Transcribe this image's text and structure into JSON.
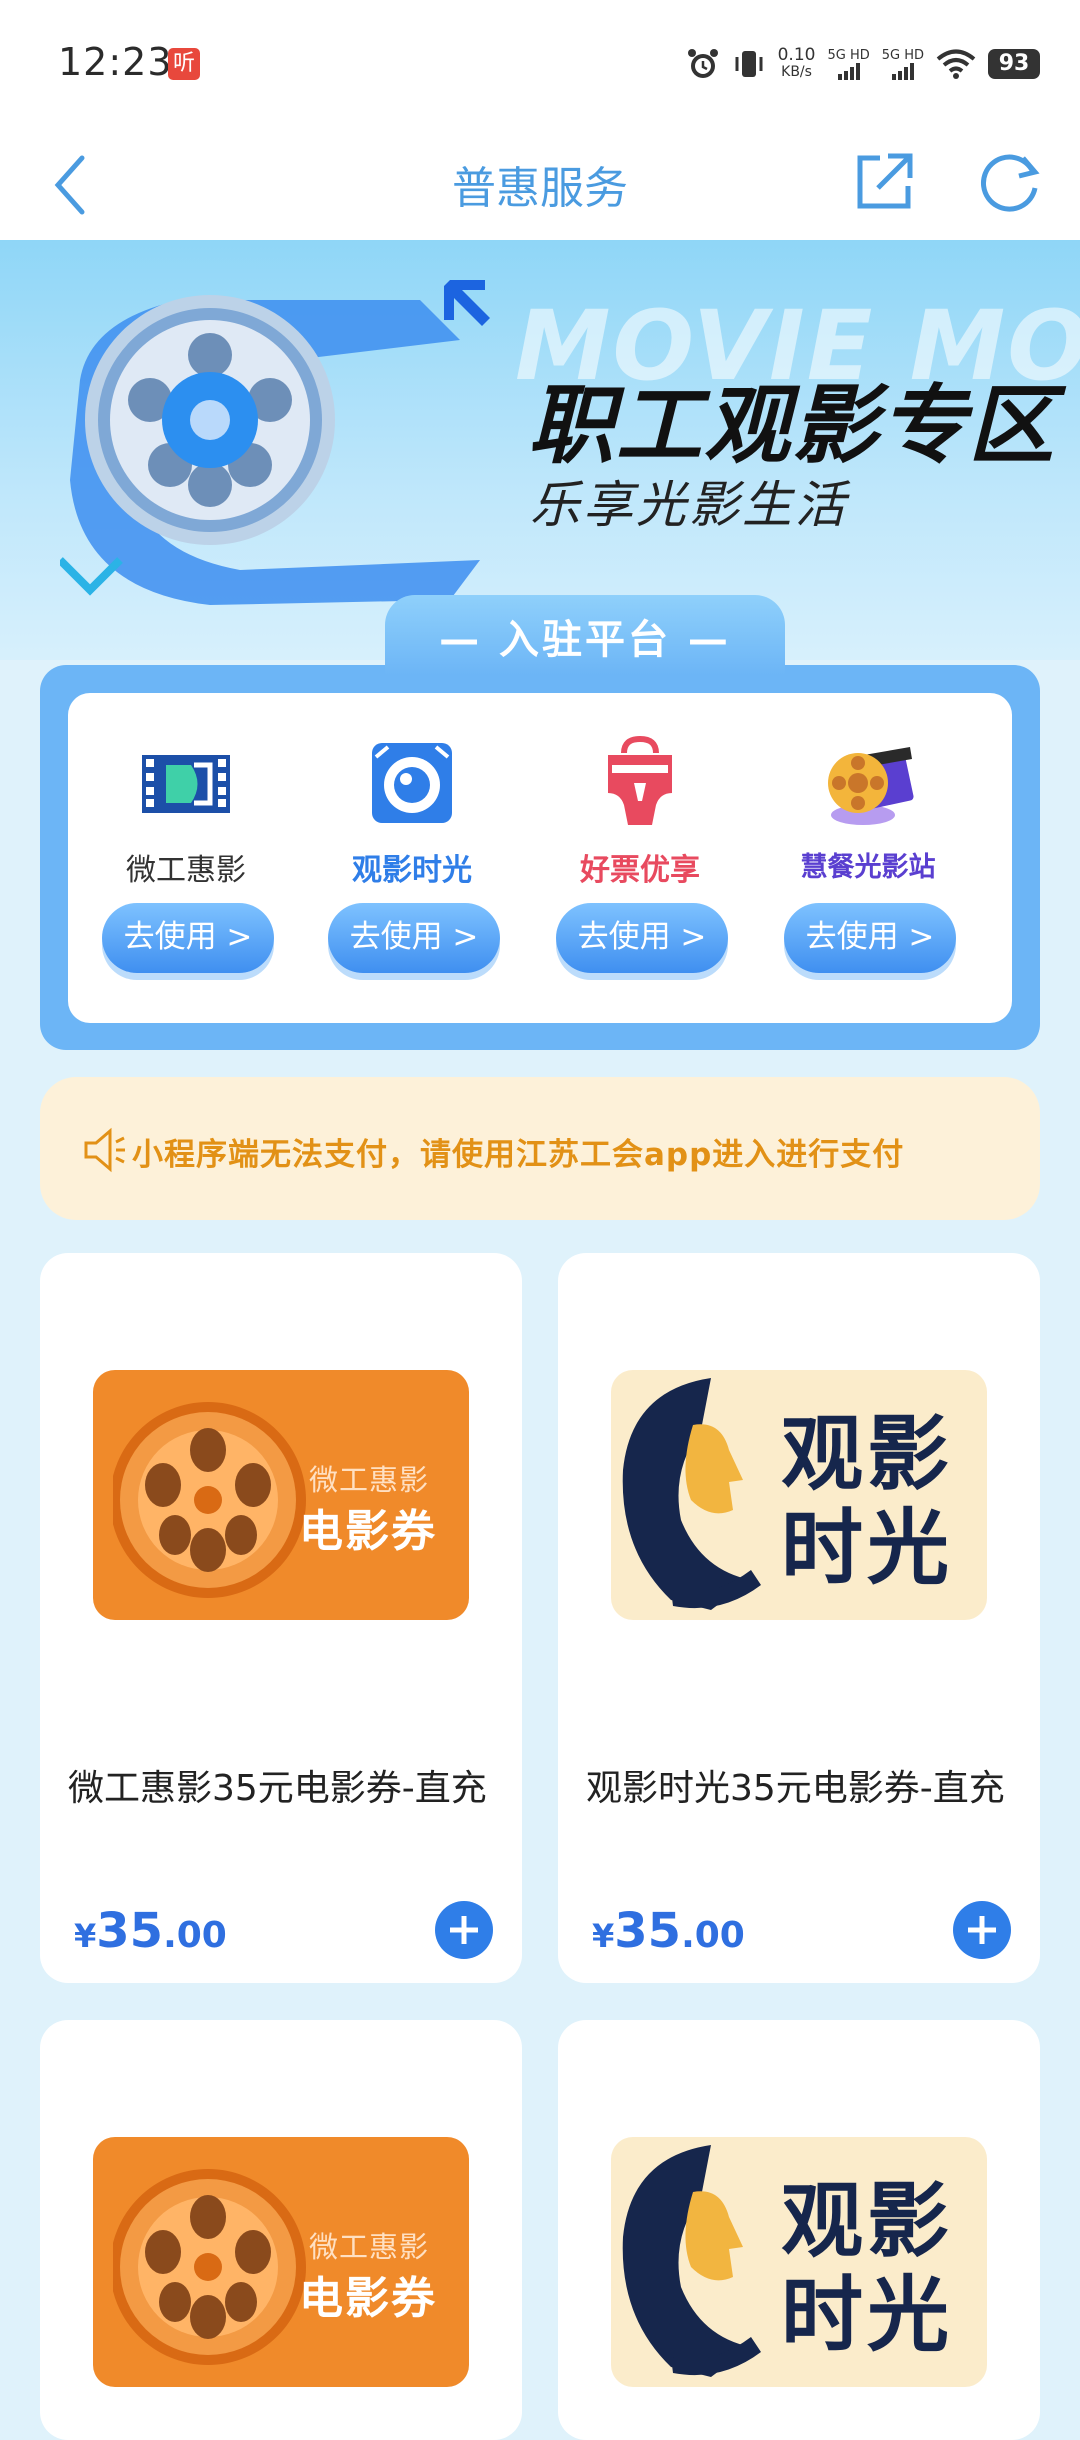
{
  "status_bar": {
    "time": "12:23",
    "notification_badge": "听",
    "net_speed_value": "0.10",
    "net_speed_unit": "KB/s",
    "signal_1": "5G HD",
    "signal_2": "5G HD",
    "battery": "93"
  },
  "nav": {
    "title": "普惠服务"
  },
  "hero": {
    "bg_text": "MOVIE MOVIE",
    "title": "职工观影专区",
    "subtitle": "乐享光影生活"
  },
  "platforms": {
    "title": "— 入驻平台 —",
    "items": [
      {
        "name": "微工惠影",
        "button": "去使用 >",
        "color": "#333333"
      },
      {
        "name": "观影时光",
        "button": "去使用 >",
        "color": "#2f7ee8"
      },
      {
        "name": "好票优享",
        "button": "去使用 >",
        "color": "#e84a5f"
      },
      {
        "name": "慧餐光影站",
        "button": "去使用 >",
        "color": "#5a3fd0"
      }
    ]
  },
  "notice": {
    "text": "小程序端无法支付，请使用江苏工会app进入进行支付"
  },
  "products": [
    {
      "name": "微工惠影35元电影券-直充",
      "price_symbol": "¥",
      "price_int": "35",
      "price_dec": ".00",
      "img_small": "微工惠影",
      "img_big": "电影券"
    },
    {
      "name": "观影时光35元电影券-直充",
      "price_symbol": "¥",
      "price_int": "35",
      "price_dec": ".00",
      "img_text": "观影时光"
    },
    {
      "img_small": "微工惠影",
      "img_big": "电影券"
    },
    {
      "img_text": "观影时光"
    }
  ],
  "colors": {
    "accent": "#2f7ee8",
    "price": "#2f6fe0",
    "notice_text": "#e29116",
    "notice_bg": "#fdf1d9"
  }
}
